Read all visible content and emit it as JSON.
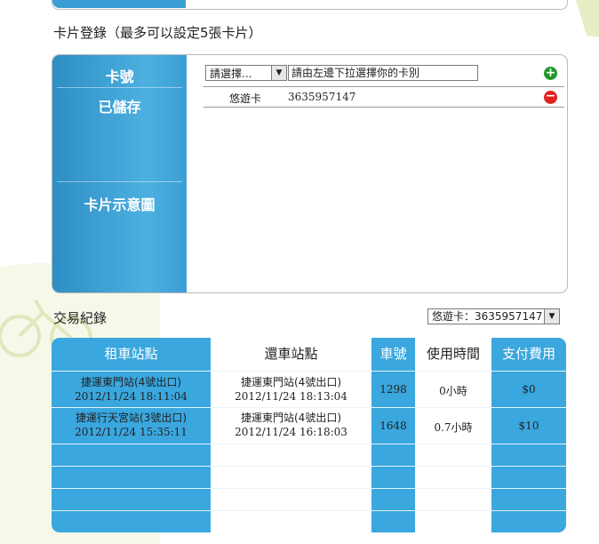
{
  "card_section": {
    "title": "卡片登錄（最多可以設定5張卡片）",
    "side_labels": {
      "card_no": "卡號",
      "saved": "已儲存",
      "card_image": "卡片示意圖"
    },
    "card_type_select": {
      "value": "請選擇..."
    },
    "card_input": {
      "value": "請由左邊下拉選擇你的卡別"
    },
    "saved_cards": [
      {
        "type": "悠遊卡",
        "number": "3635957147"
      }
    ]
  },
  "transactions": {
    "title": "交易紀錄",
    "card_filter": "悠遊卡：3635957147",
    "headers": [
      "租車站點",
      "還車站點",
      "車號",
      "使用時間",
      "支付費用"
    ],
    "rows": [
      {
        "rent_station": "捷運東門站(4號出口)",
        "rent_time": "2012/11/24 18:11:04",
        "return_station": "捷運東門站(4號出口)",
        "return_time": "2012/11/24 18:13:04",
        "bike_no": "1298",
        "duration": "0小時",
        "fee": "$0"
      },
      {
        "rent_station": "捷運行天宮站(3號出口)",
        "rent_time": "2012/11/24 15:35:11",
        "return_station": "捷運東門站(4號出口)",
        "return_time": "2012/11/24 16:18:03",
        "bike_no": "1648",
        "duration": "0.7小時",
        "fee": "$10"
      }
    ]
  },
  "colors": {
    "accent_blue": "#3aa7df",
    "add_green": "#1e9a2a",
    "remove_red": "#e02222"
  }
}
